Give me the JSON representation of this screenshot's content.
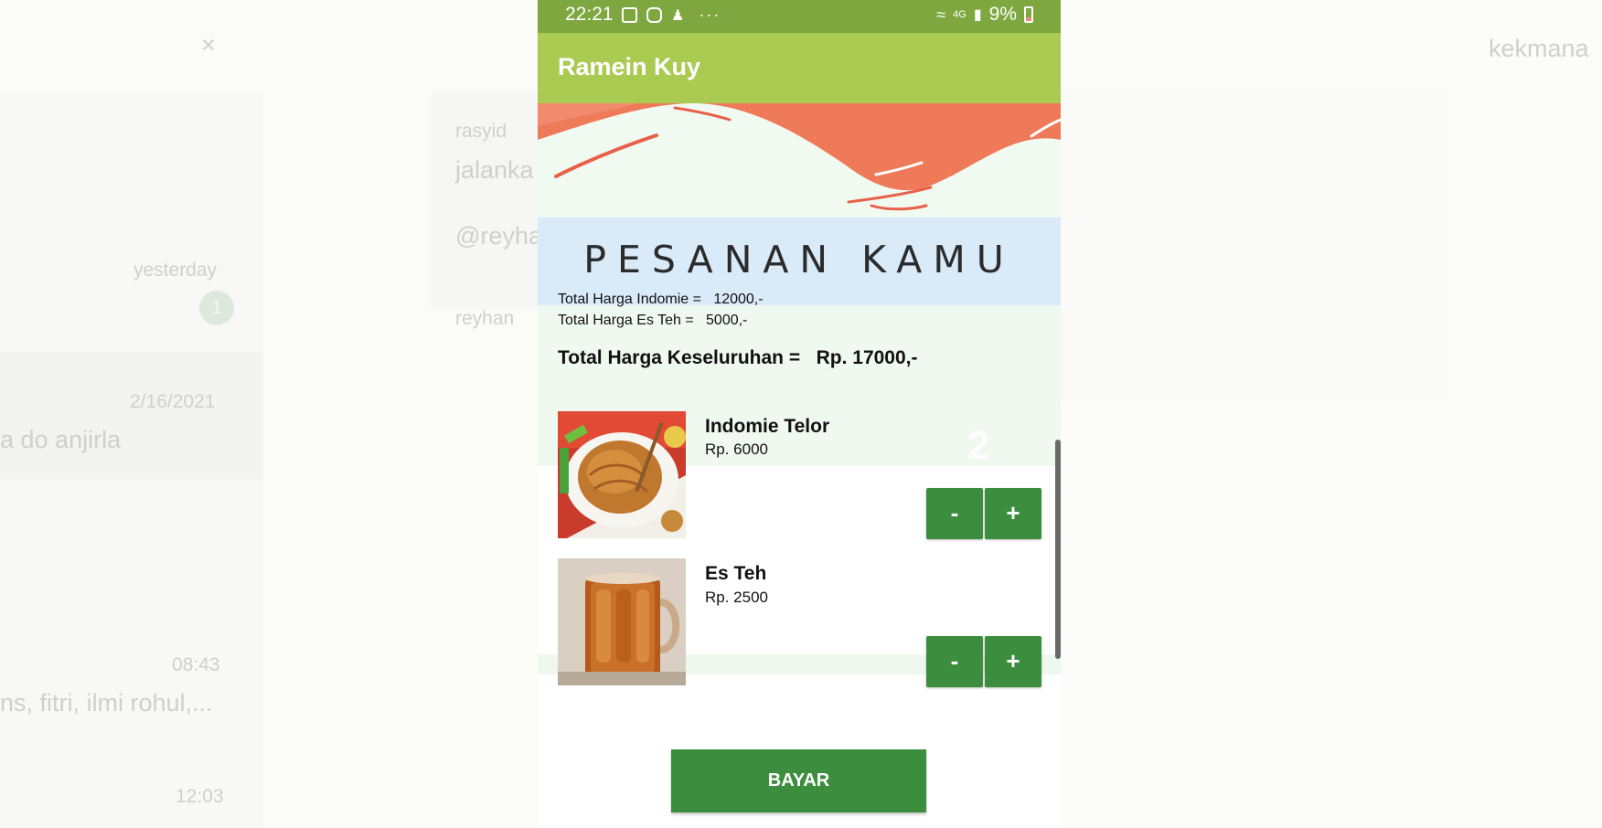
{
  "background": {
    "close_glyph": "×",
    "right_header": "kekmana",
    "chat_sender_1": "rasyid",
    "chat_text_1": "jalanka",
    "chat_mention": "@reyha",
    "chat_sender_2": "reyhan",
    "date_1": "yesterday",
    "badge_count": "1",
    "date_2": "2/16/2021",
    "preview_2": "a do anjirla",
    "date_3": "08:43",
    "preview_3": "ns, fitri, ilmi rohul,...",
    "date_4": "12:03"
  },
  "status_bar": {
    "time": "22:21",
    "dots": "···",
    "network": "4G",
    "battery_pct": "9%"
  },
  "app_bar": {
    "title": "Ramein Kuy"
  },
  "order": {
    "heading": "PESANAN KAMU",
    "line_indomie": "Total Harga Indomie =   12000,-",
    "line_esteh": "Total Harga Es Teh =   5000,-",
    "grand_total": "Total Harga Keseluruhan =   Rp. 17000,-"
  },
  "items": [
    {
      "name": "Indomie Telor",
      "price": "Rp. 6000",
      "minus": "-",
      "plus": "+"
    },
    {
      "name": "Es Teh",
      "price": "Rp. 2500",
      "minus": "-",
      "plus": "+"
    }
  ],
  "ghost_number": "2",
  "pay_button": "BAYAR",
  "colors": {
    "status_bar": "#7ea83f",
    "app_bar": "#abca51",
    "button_green": "#3c8e3e",
    "heading_band": "#d9eaf9",
    "banner_accent": "#ef7a5a"
  }
}
